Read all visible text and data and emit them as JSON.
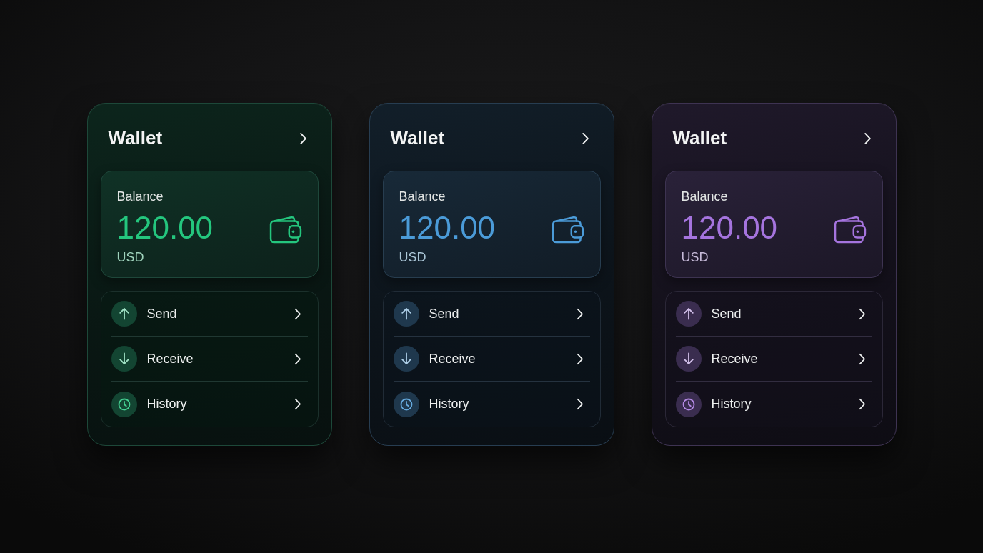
{
  "cards": [
    {
      "title": "Wallet",
      "color": "#24c67e",
      "balance": {
        "label": "Balance",
        "amount": "120.00",
        "currency": "USD"
      },
      "actions": [
        {
          "kind": "send",
          "label": "Send"
        },
        {
          "kind": "receive",
          "label": "Receive"
        },
        {
          "kind": "history",
          "label": "History"
        }
      ]
    },
    {
      "title": "Wallet",
      "color": "#4b9bd8",
      "balance": {
        "label": "Balance",
        "amount": "120.00",
        "currency": "USD"
      },
      "actions": [
        {
          "kind": "send",
          "label": "Send"
        },
        {
          "kind": "receive",
          "label": "Receive"
        },
        {
          "kind": "history",
          "label": "History"
        }
      ]
    },
    {
      "title": "Wallet",
      "color": "#a574de",
      "balance": {
        "label": "Balance",
        "amount": "120.00",
        "currency": "USD"
      },
      "actions": [
        {
          "kind": "send",
          "label": "Send"
        },
        {
          "kind": "receive",
          "label": "Receive"
        },
        {
          "kind": "history",
          "label": "History"
        }
      ]
    }
  ]
}
